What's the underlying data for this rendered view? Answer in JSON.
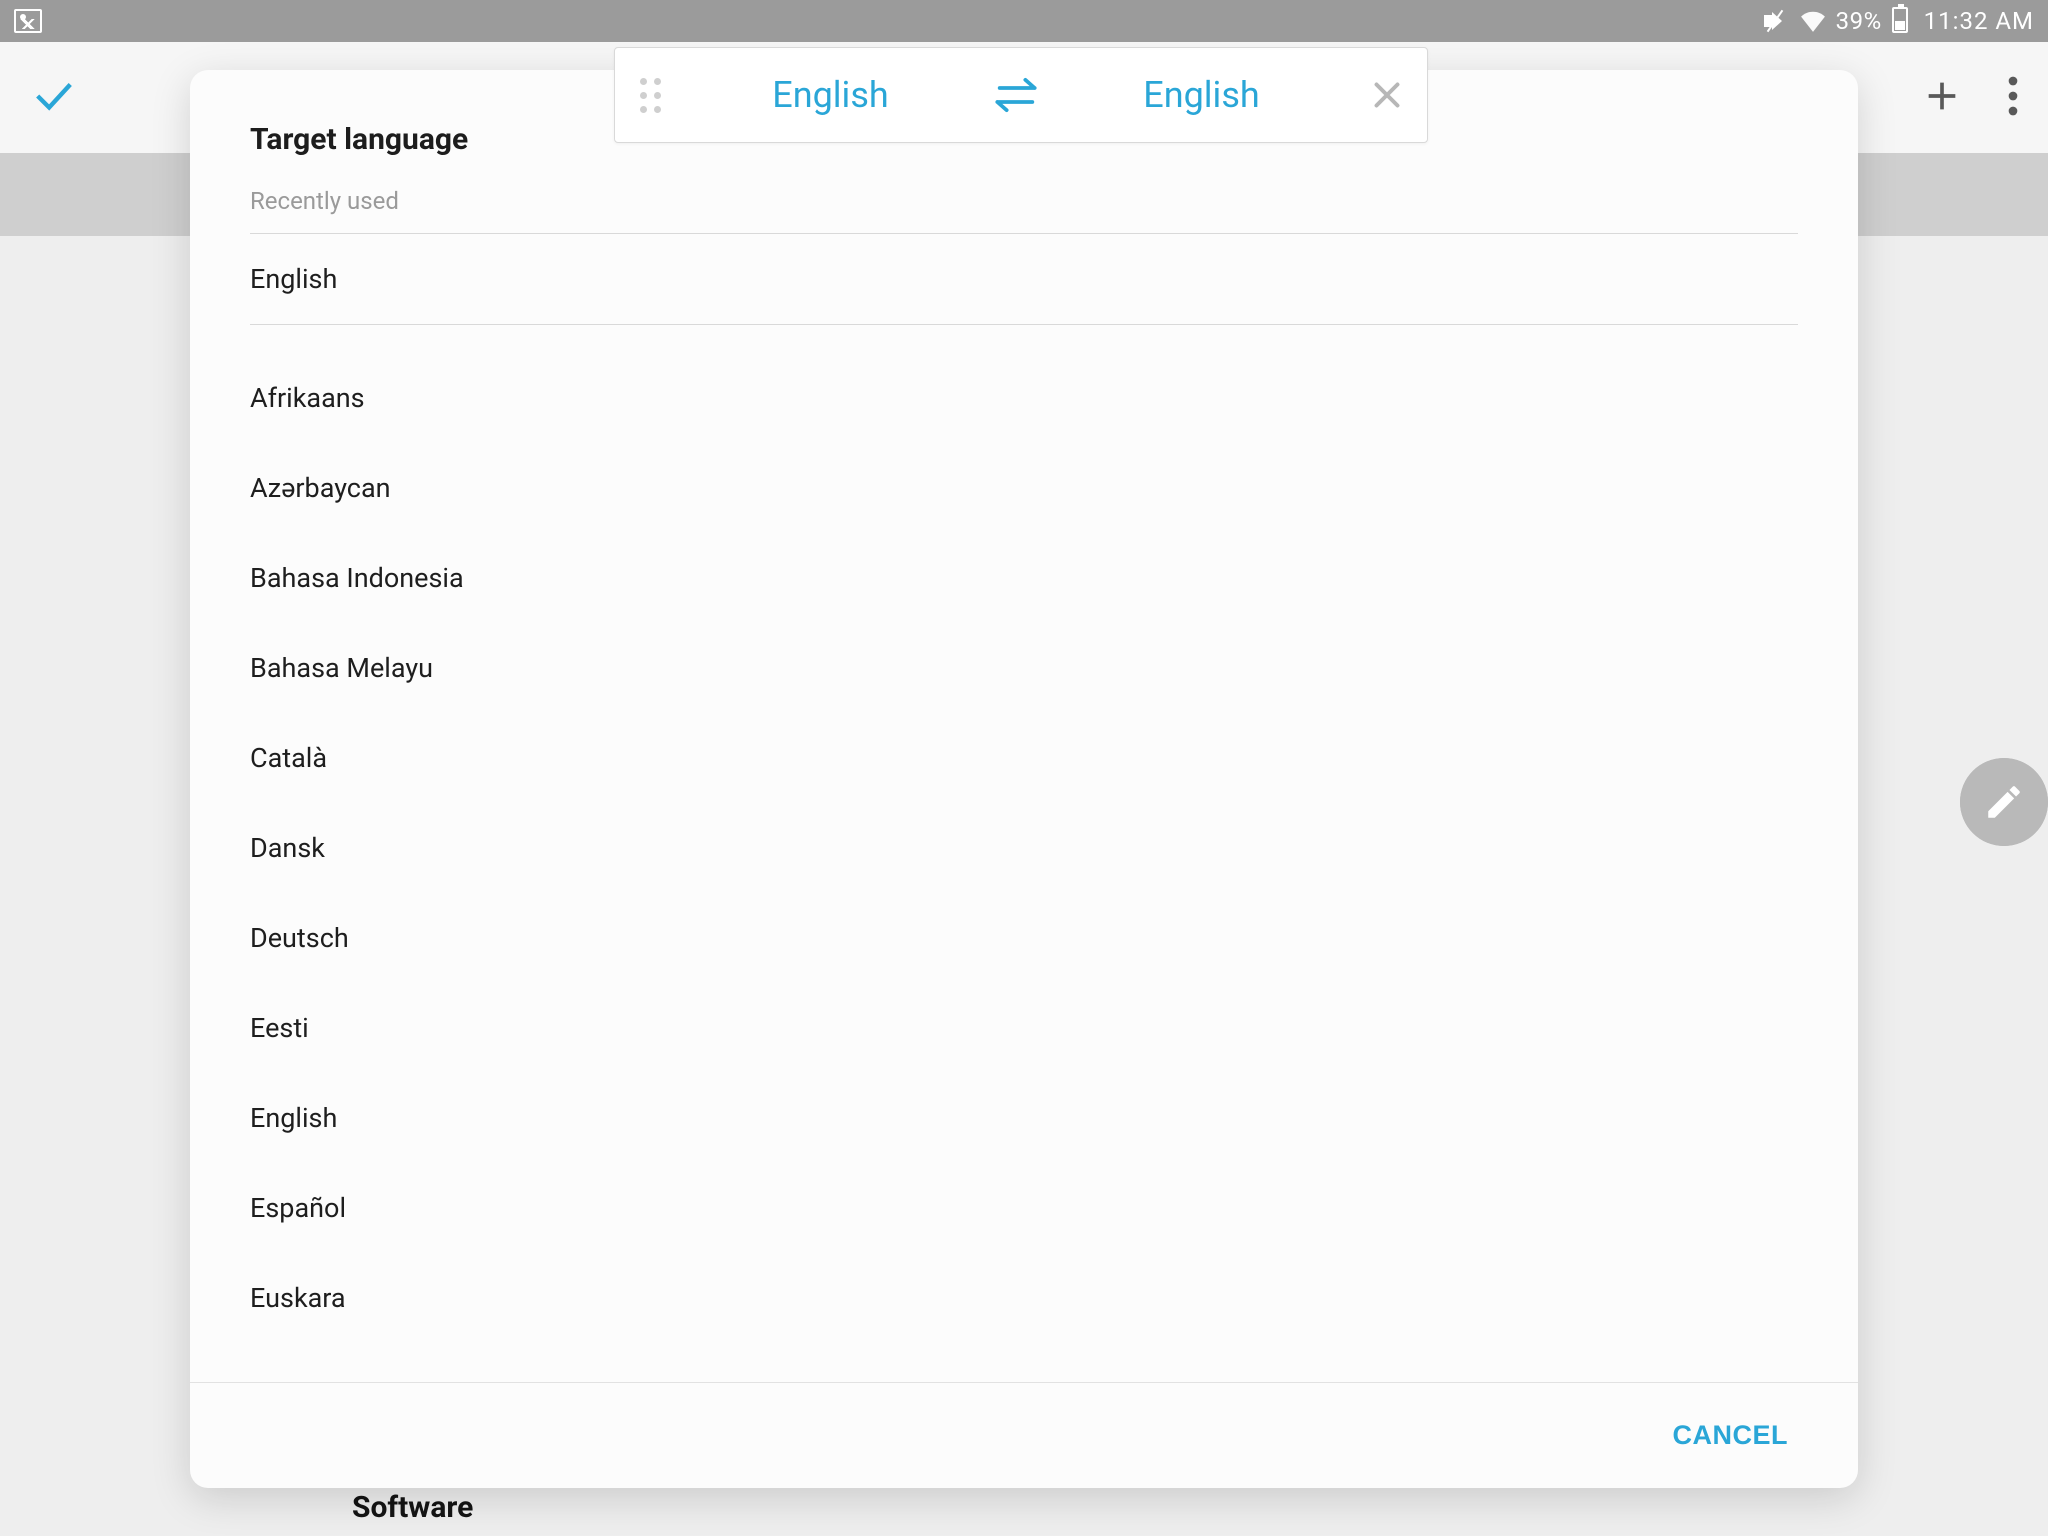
{
  "status_bar": {
    "battery_percent": "39%",
    "time": "11:32 AM"
  },
  "translate_bar": {
    "source_language": "English",
    "target_language": "English"
  },
  "dialog": {
    "title": "Target language",
    "recent_label": "Recently used",
    "recent_items": [
      "English"
    ],
    "all_items": [
      "Afrikaans",
      "Azərbaycan",
      "Bahasa Indonesia",
      "Bahasa Melayu",
      "Català",
      "Dansk",
      "Deutsch",
      "Eesti",
      "English",
      "Español",
      "Euskara"
    ],
    "cancel_label": "CANCEL"
  },
  "background": {
    "peek_heading": "Software"
  }
}
